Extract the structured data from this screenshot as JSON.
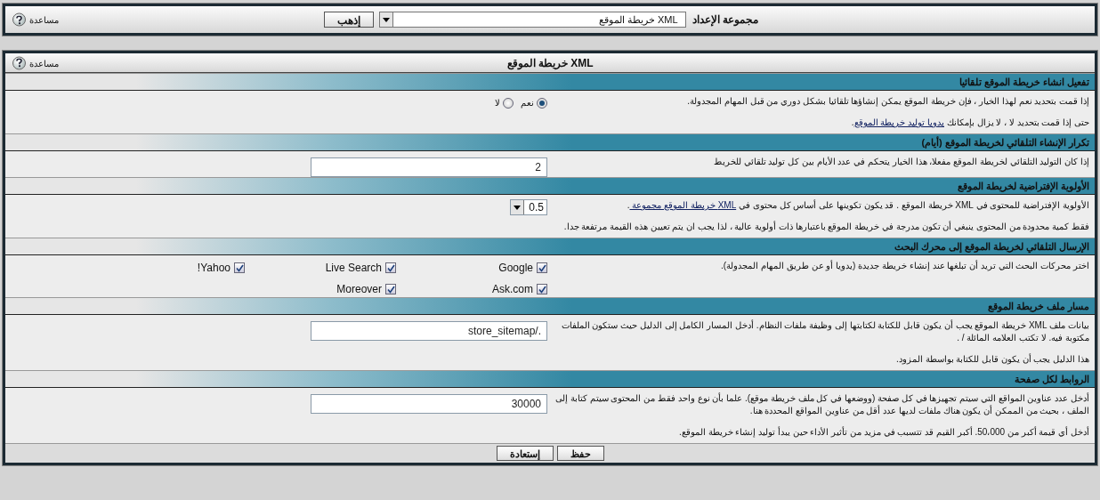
{
  "top_bar": {
    "label": "مجموعة الإعداد",
    "select_value": "XML خريطة الموقع",
    "go_button": "إذهب",
    "help": "مساعدة"
  },
  "panel": {
    "title": "XML خريطة الموقع",
    "help": "مساعدة"
  },
  "sections": [
    {
      "title": "تفعيل انشاء خريطة الموقع تلقائيا",
      "paragraphs": [
        [
          {
            "kind": "text",
            "text": "إذا قمت بتحديد نعم لهذا الخيار ، فإن خريطة الموقع يمكن إنشاؤها تلقائيا بشكل دوري من قبل المهام المجدولة."
          }
        ],
        [
          {
            "kind": "text",
            "text": "حتى إذا قمت بتحديد لا ، لا يزال بإمكانك "
          },
          {
            "kind": "link",
            "text": "يدويا توليد خريطة الموقع"
          },
          {
            "kind": "text",
            "text": "."
          }
        ]
      ],
      "control": {
        "kind": "radio",
        "options": [
          {
            "label": "نعم",
            "selected": true
          },
          {
            "label": "لا",
            "selected": false
          }
        ]
      }
    },
    {
      "title": "تكرار الإنشاء التلقائي لخريطة الموقع (أيام)",
      "paragraphs": [
        [
          {
            "kind": "text",
            "text": "إذا كان التوليد التلقائي لخريطة الموقع مفعلا، هذا الخيار يتحكم في عدد الأيام بين كل توليد تلقائي للخريط"
          }
        ]
      ],
      "control": {
        "kind": "text",
        "value": "2"
      }
    },
    {
      "title": "الأولوية الإفتراضية لخريطة الموقع",
      "paragraphs": [
        [
          {
            "kind": "text",
            "text": "الأولوية الإفتراضية للمحتوى في XML خريطة الموقع . قد يكون تكوينها على أساس كل محتوى في "
          },
          {
            "kind": "link",
            "text": "XML خريطة الموقع مجموعة "
          },
          {
            "kind": "text",
            "text": "."
          }
        ],
        [
          {
            "kind": "text",
            "text": "فقط كمية محدودة من المحتوى ينبغي أن تكون مدرجة في خريطة الموقع باعتبارها ذات أولوية عالية ، لذا يجب ان يتم تعيين هذه القيمة مرتفعة جدا."
          }
        ]
      ],
      "control": {
        "kind": "select",
        "value": "0.5"
      }
    },
    {
      "title": "الإرسال التلقائي لخريطة الموقع إلى محرك البحث",
      "paragraphs": [
        [
          {
            "kind": "text",
            "text": "اختر محركات البحث التي تريد أن تبلغها عند إنشاء خريطة جديدة (يدويا أو عن طريق المهام المجدولة)."
          }
        ]
      ],
      "control": {
        "kind": "checkboxes",
        "options": [
          {
            "label": "Google",
            "checked": true
          },
          {
            "label": "Live Search",
            "checked": true
          },
          {
            "label": "Yahoo!",
            "checked": true
          },
          {
            "label": "Ask.com",
            "checked": true
          },
          {
            "label": "Moreover",
            "checked": true
          }
        ]
      }
    },
    {
      "title": "مسار ملف خريطة الموقع",
      "paragraphs": [
        [
          {
            "kind": "text",
            "text": "بيانات ملف XML خريطة الموقع يجب أن يكون قابل للكتابة لكتابتها إلى وظيفة ملفات النظام. أدخل المسار الكامل إلى الدليل حيث ستكون الملفات مكتوبة فيه. لا تكتب العلامه المائلة / ."
          }
        ],
        [
          {
            "kind": "text",
            "text": "هذا الدليل يجب أن يكون قابل للكتابة بواسطة المزود."
          }
        ]
      ],
      "control": {
        "kind": "text",
        "value": "./store_sitemap"
      }
    },
    {
      "title": "الروابط لكل صفحة",
      "paragraphs": [
        [
          {
            "kind": "text",
            "text": "أدخل عدد عناوين المواقع التي سيتم تجهيزها في كل صفحة (ووضعها في كل ملف خريطة موقع). علما بأن نوع واحد فقط من المحتوى سيتم كتابة إلى الملف ، بحيث من الممكن أن يكون هناك ملفات لديها عدد أقل من عناوين المواقع المحددة هنا."
          }
        ],
        [
          {
            "kind": "text",
            "text": "أدخل أي قيمة أكبر من 50،000. أكبر القيم قد تتسبب في مزيد من تأثير الأداء حين يبدأ توليد إنشاء خريطة الموقع."
          }
        ]
      ],
      "control": {
        "kind": "text",
        "value": "30000"
      }
    }
  ],
  "footer_buttons": [
    "حفظ",
    "إستعادة"
  ]
}
